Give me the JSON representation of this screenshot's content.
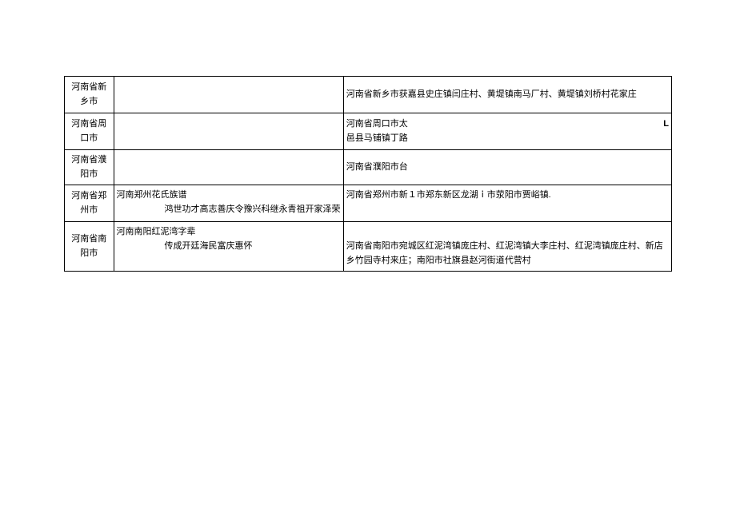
{
  "rows": [
    {
      "city": "河南省新乡市",
      "middle": "",
      "right": "河南省新乡市获嘉县史庄镇闫庄村、黄堤镇南马厂村、黄堤镇刘桥村花家庄"
    },
    {
      "city": "河南省周口市",
      "middle": "",
      "right_line1": "河南省周口市太",
      "right_badge": "L",
      "right_line2": "邑县马铺镇丁路"
    },
    {
      "city": "河南省濮阳市",
      "middle": "",
      "right": "河南省濮阳市台"
    },
    {
      "city": "河南省郑州市",
      "middle_line1": "河南郑州花氏族谱",
      "middle_line2": "鸿世功才高志善庆令豫兴科继永青祖开家泽荣",
      "right": "河南省郑州市新１市郑东新区龙湖ｉ市荥阳市贾峪镇."
    },
    {
      "city": "河南省南阳市",
      "middle_line1": "河南南阳红泥湾字辈",
      "middle_line2": "传成开廷海民富庆惠怀",
      "right": "河南省南阳市宛城区红泥湾镇庞庄村、红泥湾镇大李庄村、红泥湾镇庞庄村、新店乡竹园寺村来庄；南阳市社旗县赵河街道代营村"
    }
  ]
}
